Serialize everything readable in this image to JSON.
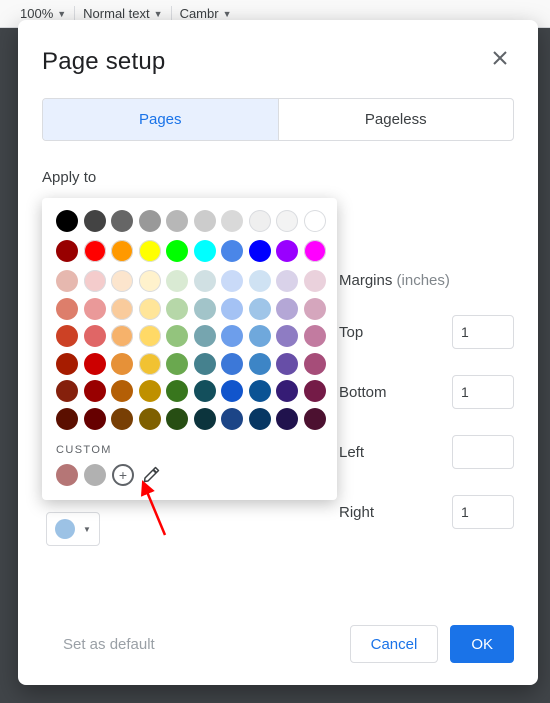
{
  "background_toolbar": {
    "zoom": "100%",
    "style": "Normal text",
    "font": "Cambr"
  },
  "dialog": {
    "title": "Page setup",
    "tabs": {
      "pages": "Pages",
      "pageless": "Pageless"
    },
    "apply_to": "Apply to",
    "margins": {
      "heading": "Margins",
      "unit": "(inches)",
      "top_label": "Top",
      "bottom_label": "Bottom",
      "left_label": "Left",
      "right_label": "Right",
      "top": "1",
      "bottom": "1",
      "left": "",
      "right": "1"
    },
    "footer": {
      "set_default": "Set as default",
      "cancel": "Cancel",
      "ok": "OK"
    }
  },
  "picker": {
    "custom_label": "CUSTOM",
    "selected_hex": "#9cc3e6",
    "gray_row": [
      "#000000",
      "#434343",
      "#666666",
      "#999999",
      "#b7b7b7",
      "#cccccc",
      "#d9d9d9",
      "#efefef",
      "#f3f3f3",
      "#ffffff"
    ],
    "base_row": [
      "#980000",
      "#ff0000",
      "#ff9900",
      "#ffff00",
      "#00ff00",
      "#00ffff",
      "#4a86e8",
      "#0000ff",
      "#9900ff",
      "#ff00ff"
    ],
    "shade_grid": [
      [
        "#e6b8af",
        "#f4cccc",
        "#fce5cd",
        "#fff2cc",
        "#d9ead3",
        "#d0e0e3",
        "#c9daf8",
        "#cfe2f3",
        "#d9d2e9",
        "#ead1dc"
      ],
      [
        "#dd7e6b",
        "#ea9999",
        "#f9cb9c",
        "#ffe599",
        "#b6d7a8",
        "#a2c4c9",
        "#a4c2f4",
        "#9fc5e8",
        "#b4a7d6",
        "#d5a6bd"
      ],
      [
        "#cc4125",
        "#e06666",
        "#f6b26b",
        "#ffd966",
        "#93c47d",
        "#76a5af",
        "#6d9eeb",
        "#6fa8dc",
        "#8e7cc3",
        "#c27ba0"
      ],
      [
        "#a61c00",
        "#cc0000",
        "#e69138",
        "#f1c232",
        "#6aa84f",
        "#45818e",
        "#3c78d8",
        "#3d85c6",
        "#674ea7",
        "#a64d79"
      ],
      [
        "#85200c",
        "#990000",
        "#b45f06",
        "#bf9000",
        "#38761d",
        "#134f5c",
        "#1155cc",
        "#0b5394",
        "#351c75",
        "#741b47"
      ],
      [
        "#5b0f00",
        "#660000",
        "#783f04",
        "#7f6000",
        "#274e13",
        "#0c343d",
        "#1c4587",
        "#073763",
        "#20124d",
        "#4c1130"
      ]
    ],
    "custom_swatches": [
      "#b57676",
      "#b1b1b1"
    ]
  },
  "color_chip": {
    "hex": "#9cc2e5"
  }
}
